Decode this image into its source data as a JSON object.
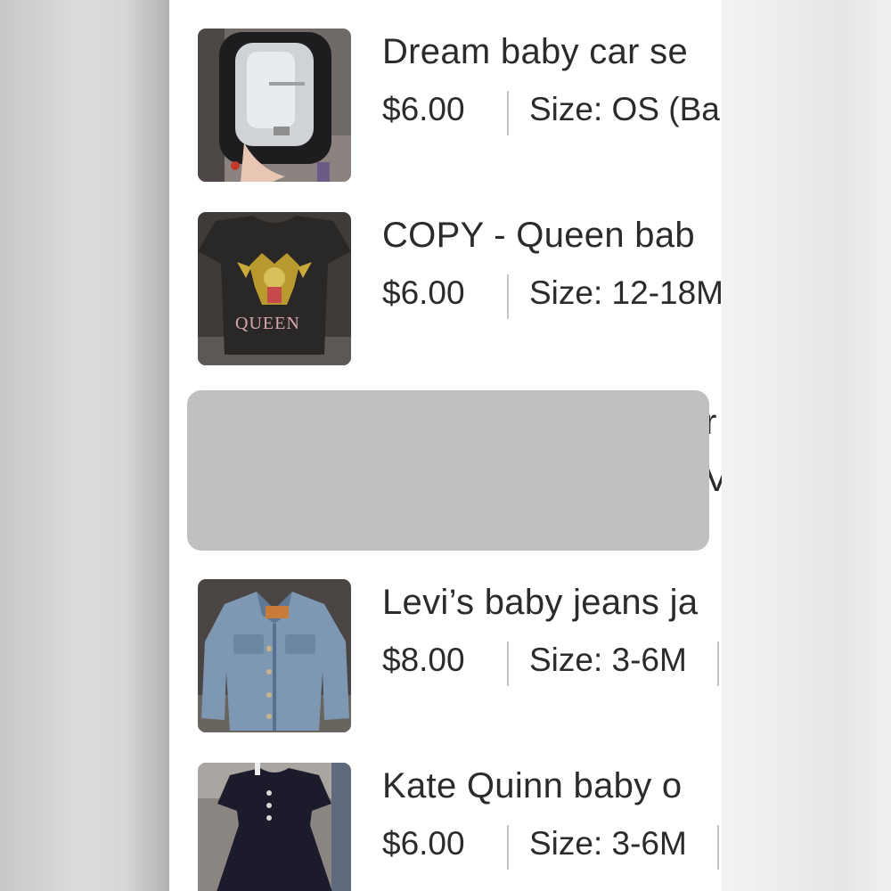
{
  "listings": [
    {
      "title": "Dream baby car se",
      "price": "$6.00",
      "size": "Size: OS (Ba",
      "thumbnail_icon": "car-seat-mirror-photo"
    },
    {
      "title": "COPY - Queen bab",
      "price": "$6.00",
      "size": "Size: 12-18M",
      "thumbnail_icon": "queen-tshirt-photo",
      "thumb_print": "QUEEN"
    },
    {
      "title": "Levi’s baby jeans ja",
      "price": "$8.00",
      "size": "Size: 3-6M",
      "thumbnail_icon": "denim-jacket-photo"
    },
    {
      "title": "Kate Quinn baby o",
      "price": "$6.00",
      "size": "Size: 3-6M",
      "thumbnail_icon": "black-dress-photo"
    }
  ],
  "hidden_listing": {
    "peek_line1": "r",
    "peek_line2": "V"
  },
  "colors": {
    "text": "#2b2b2b",
    "separator": "#c4c4c4",
    "redaction": "#c0c0c0"
  }
}
